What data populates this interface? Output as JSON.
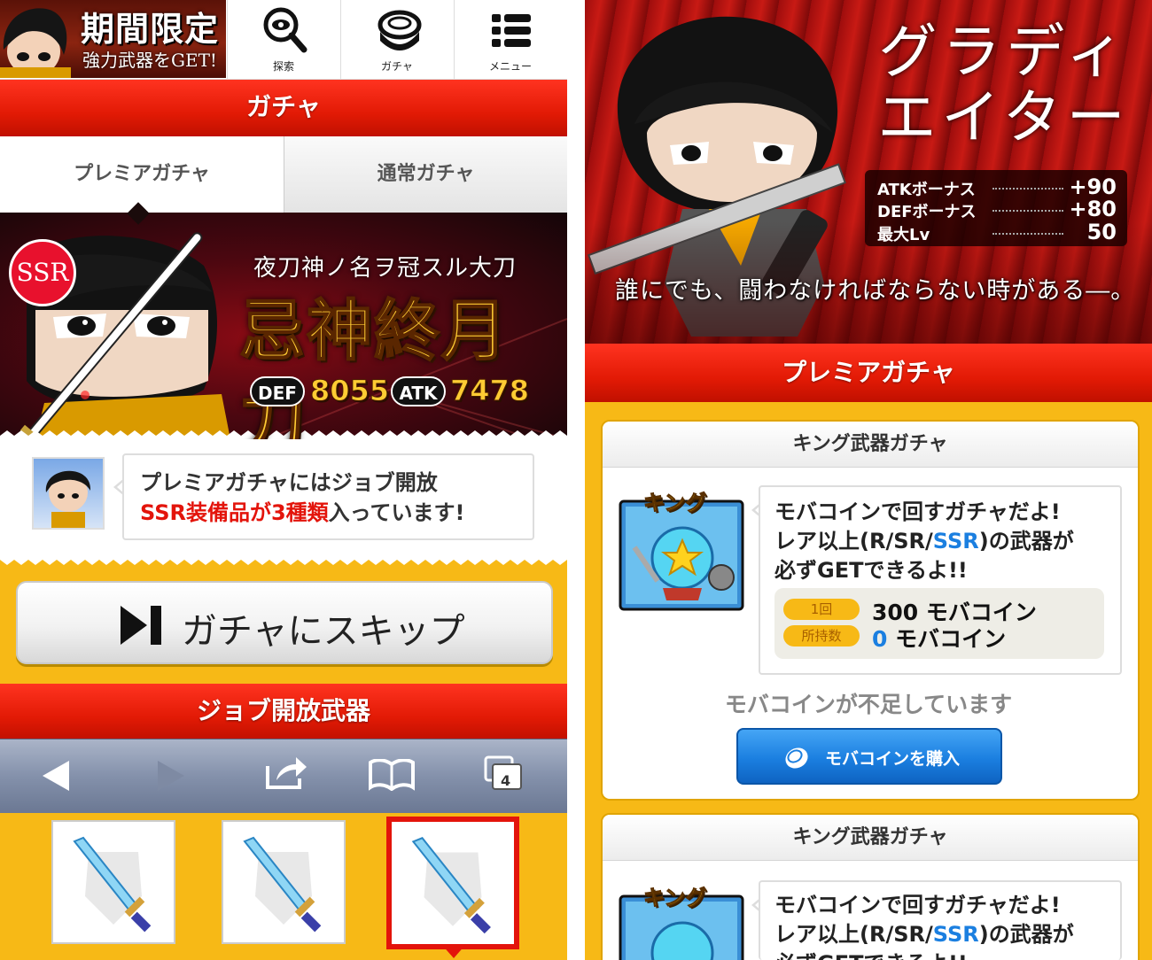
{
  "left": {
    "banner": {
      "line1": "期間限定",
      "line2": "強力武器をGET!"
    },
    "nav": [
      {
        "label": "探索",
        "icon": "magnifier-icon"
      },
      {
        "label": "ガチャ",
        "icon": "gacha-capsule-icon"
      },
      {
        "label": "メニュー",
        "icon": "menu-list-icon"
      }
    ],
    "header_title": "ガチャ",
    "tabs": [
      {
        "label": "プレミアガチャ",
        "active": true
      },
      {
        "label": "通常ガチャ",
        "active": false
      }
    ],
    "featured": {
      "rarity": "SSR",
      "subtitle": "夜刀神ノ名ヲ冠スル大刀",
      "name": "忌神終月刀",
      "def_label": "DEF",
      "def_value": "8055",
      "atk_label": "ATK",
      "atk_value": "7478"
    },
    "info": {
      "line1": "プレミアガチャにはジョブ開放",
      "line2_red": "SSR装備品が3種類",
      "line2_rest": "入っています!"
    },
    "skip_button": "ガチャにスキップ",
    "section_title": "ジョブ開放武器",
    "browser_toolbar": {
      "tab_count": "4"
    },
    "weapons": [
      {
        "icon": "sword-icon",
        "selected": false
      },
      {
        "icon": "sword-icon",
        "selected": false
      },
      {
        "icon": "sword-icon",
        "selected": true
      }
    ]
  },
  "right": {
    "character": {
      "name_line1": "グラディ",
      "name_line2": "エイター",
      "stats": [
        {
          "label": "ATKボーナス",
          "value": "+90"
        },
        {
          "label": "DEFボーナス",
          "value": "+80"
        },
        {
          "label": "最大Lv",
          "value": "50"
        }
      ],
      "quote": "誰にでも、闘わなければならない時がある―。"
    },
    "section_title": "プレミアガチャ",
    "cards": [
      {
        "title": "キング武器ガチャ",
        "badge": "キング",
        "desc_line1": "モバコインで回すガチャだよ!",
        "desc_line2_pre": "レア以上(R/SR/",
        "desc_line2_ssr": "SSR",
        "desc_line2_post": ")の武器が",
        "desc_line3": "必ずGETできるよ!!",
        "cost_label": "1回",
        "cost_value": "300 モバコイン",
        "owned_label": "所持数",
        "owned_value": "0",
        "owned_unit": " モバコイン",
        "warning": "モバコインが不足しています",
        "buy_button": "モバコインを購入"
      },
      {
        "title": "キング武器ガチャ",
        "badge": "キング",
        "desc_line1": "モバコインで回すガチャだよ!",
        "desc_line2_pre": "レア以上(R/SR/",
        "desc_line2_ssr": "SSR",
        "desc_line2_post": ")の武器が",
        "desc_line3": "必ずGETできるよ!!"
      }
    ]
  },
  "colors": {
    "accent_red": "#e21a05",
    "background_yellow": "#f7b916",
    "link_blue": "#1b7fe0",
    "gold_text": "#ffcc33"
  }
}
